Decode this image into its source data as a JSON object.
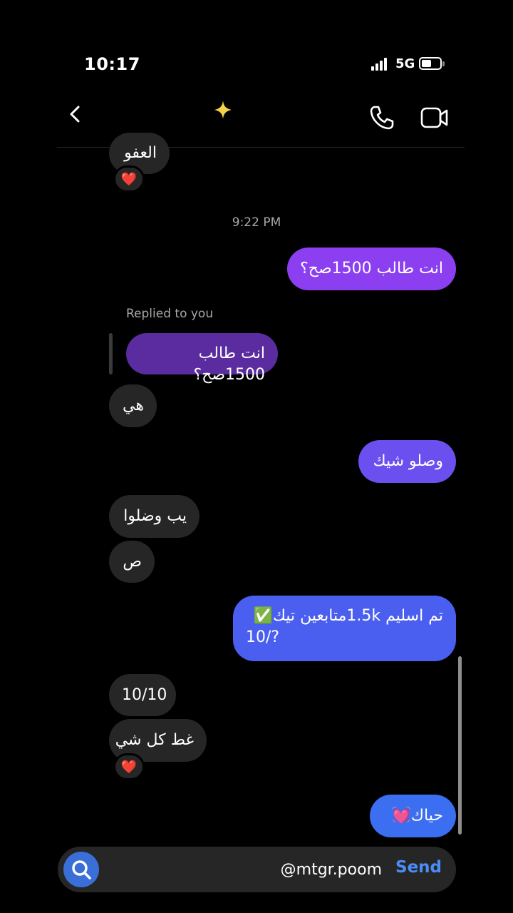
{
  "status_bar": {
    "time": "10:17",
    "network": "5G"
  },
  "header": {
    "sparkle": "✨"
  },
  "messages": {
    "partial_top": "العفو",
    "reaction_heart": "❤️",
    "timestamp": "9:22 PM",
    "out_1": "انت طالب 1500صح؟",
    "replied_label": "Replied to you",
    "quoted_reply": "انت طالب 1500صح؟",
    "in_1": "هي",
    "out_2": "وصلو شيك",
    "in_2": "يب وضلوا",
    "in_3": "ص",
    "out_3_line1": "تم اسليم 1.5kمتابعين تيك✅",
    "out_3_line2": "10/?",
    "in_4": "10/10",
    "in_5": "غط كل شي",
    "out_4": "حياك💓"
  },
  "composer": {
    "value": "@mtgr.poom",
    "send_label": "Send"
  },
  "colors": {
    "purple": "#8b3ff0",
    "violet": "#6c4fef",
    "blue": "#4a5ff0",
    "send_blue": "#4b8df8"
  }
}
